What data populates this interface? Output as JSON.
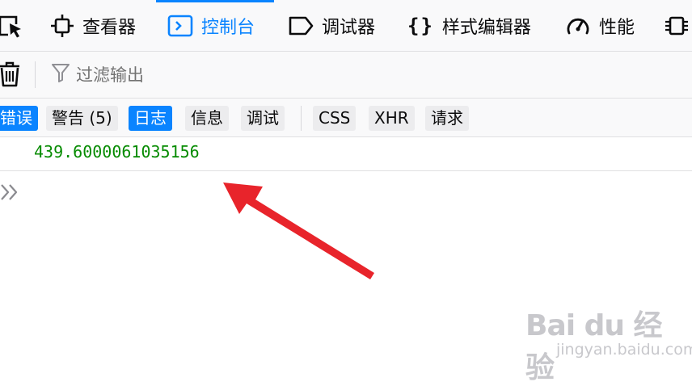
{
  "toolbox": {
    "tabs": [
      {
        "label": "",
        "icon": "element-picker-icon"
      },
      {
        "label": "查看器",
        "icon": "inspector-icon"
      },
      {
        "label": "控制台",
        "icon": "console-icon",
        "active": true
      },
      {
        "label": "调试器",
        "icon": "debugger-icon"
      },
      {
        "label": "样式编辑器",
        "icon": "style-editor-icon"
      },
      {
        "label": "性能",
        "icon": "performance-icon"
      },
      {
        "label": "",
        "icon": "memory-icon"
      }
    ],
    "accent_color": "#0a84ff"
  },
  "console_toolbar": {
    "clear_icon": "trash-icon",
    "filter_icon": "funnel-icon",
    "filter_placeholder": "过滤输出"
  },
  "filters": {
    "chips": [
      {
        "label": "错误",
        "active": true
      },
      {
        "label": "警告 (5)",
        "active": false
      },
      {
        "label": "日志",
        "active": true
      },
      {
        "label": "信息",
        "active": false
      },
      {
        "label": "调试",
        "active": false
      },
      {
        "label": "CSS",
        "active": false
      },
      {
        "label": "XHR",
        "active": false
      },
      {
        "label": "请求",
        "active": false
      }
    ]
  },
  "output": {
    "messages": [
      {
        "text": "439.6000061035156",
        "color": "#058b00"
      }
    ],
    "prompt_icon": "double-chevron-right-icon"
  },
  "annotation": {
    "arrow_color": "#e8242b"
  },
  "watermark": {
    "brand": "Bai du 经验",
    "url": "jingyan.baidu.com"
  }
}
